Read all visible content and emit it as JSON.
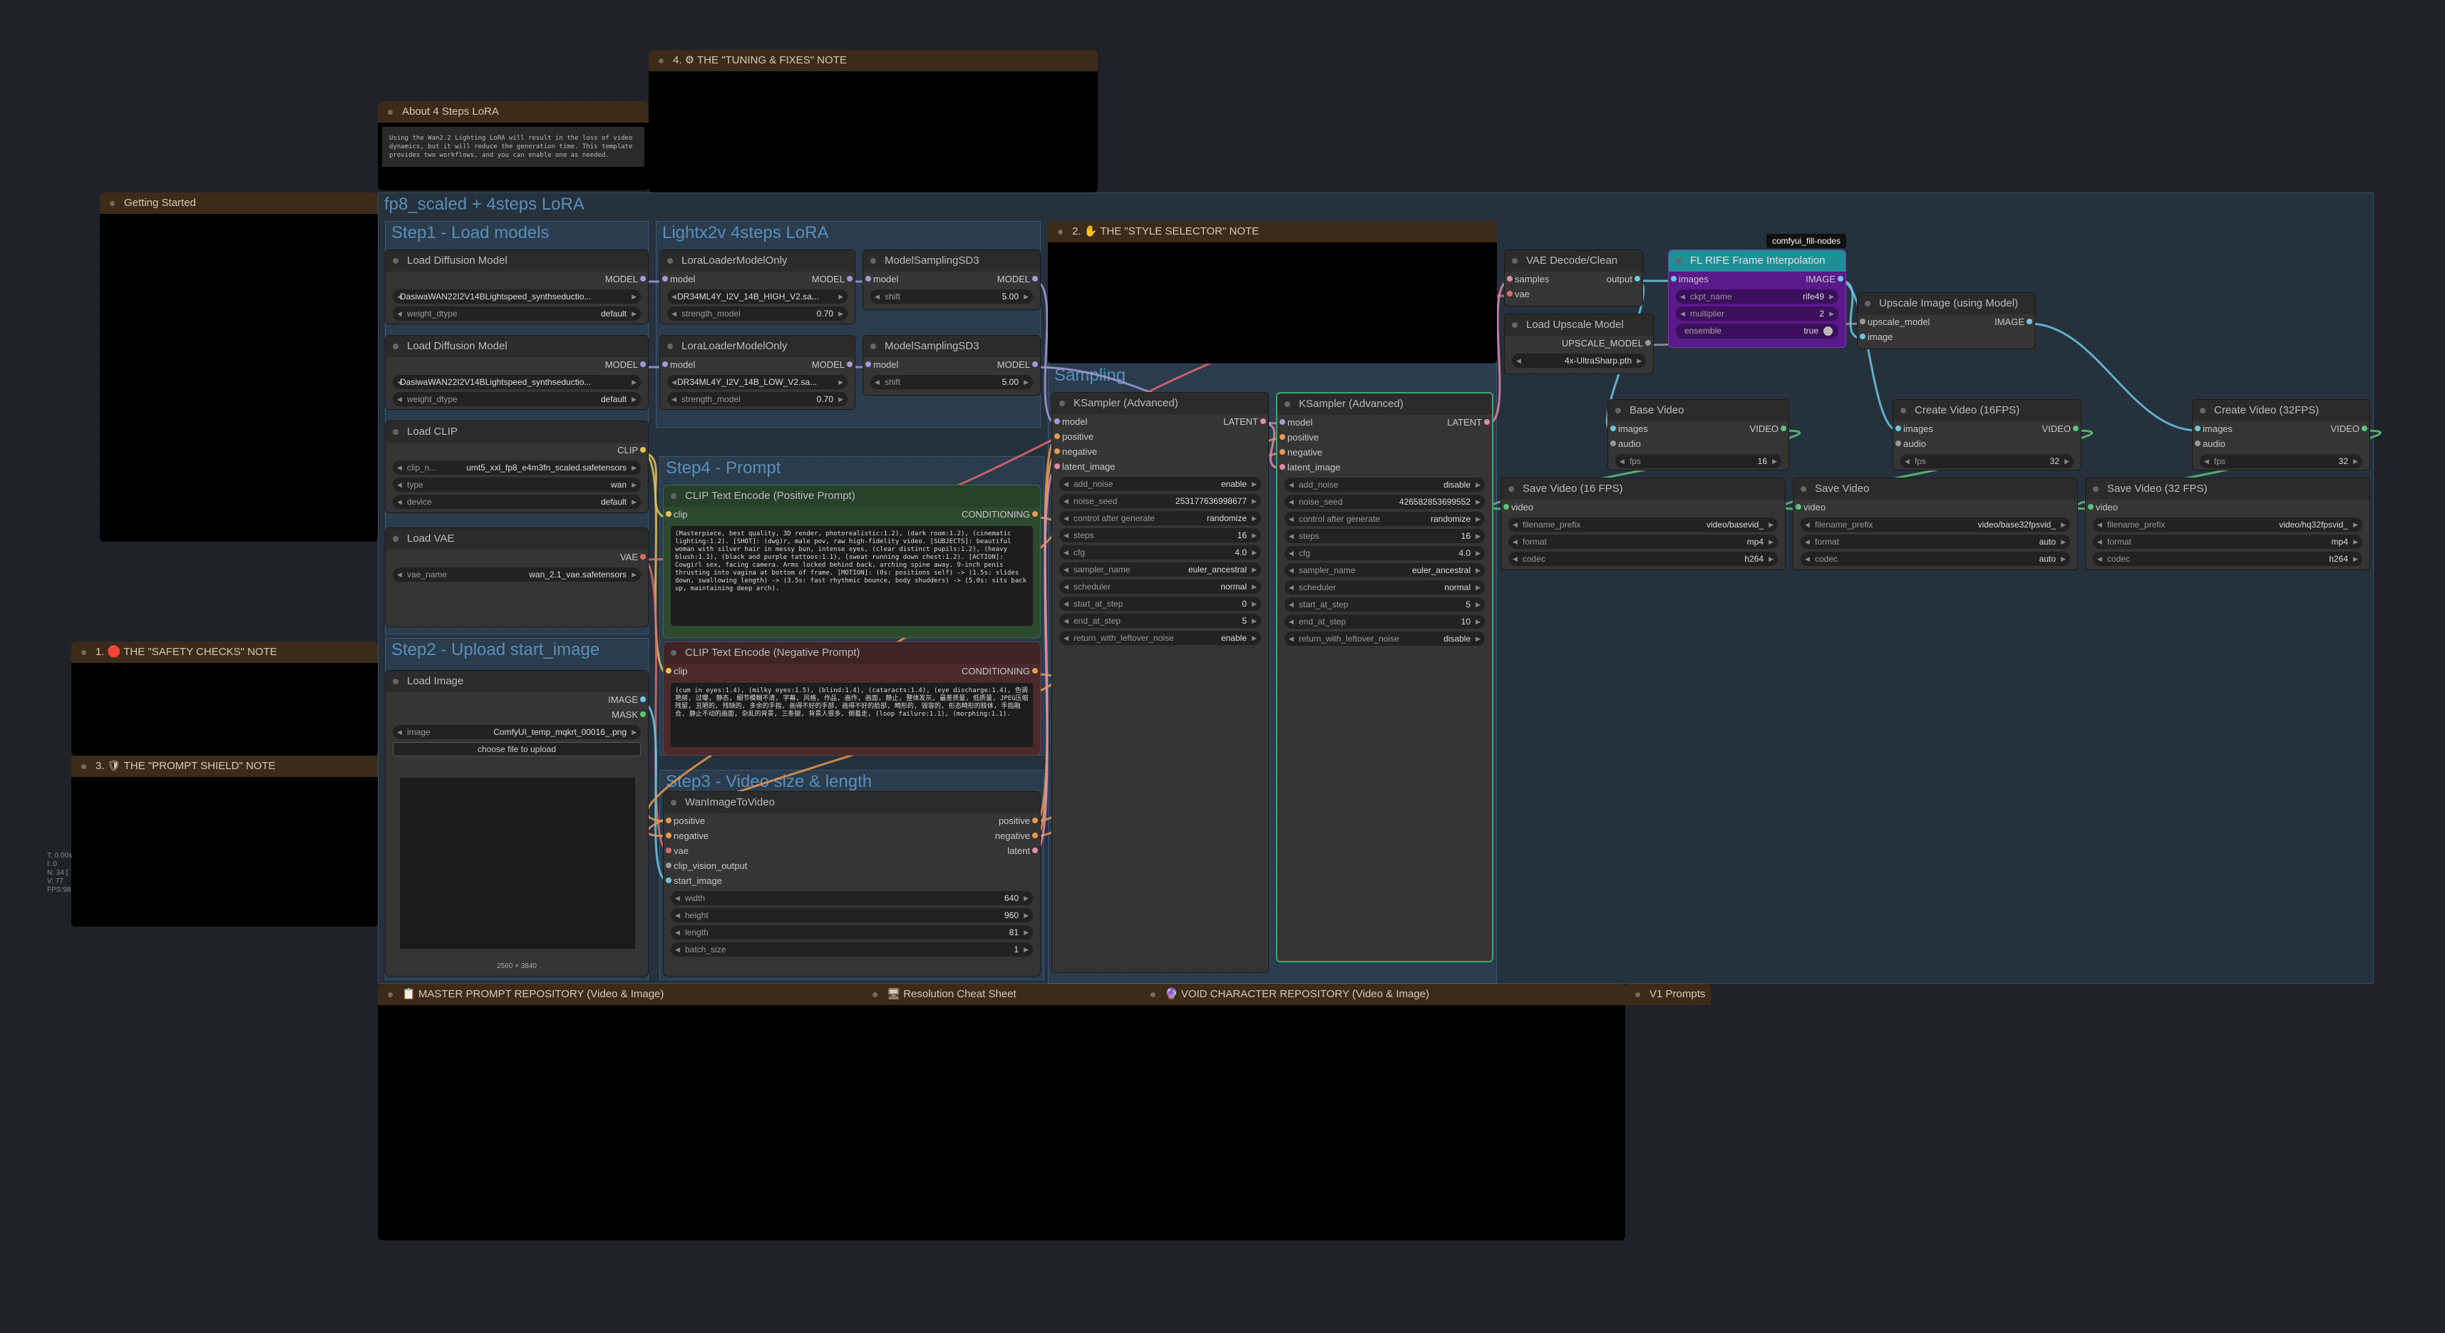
{
  "groups": {
    "main": "fp8_scaled +  4steps LoRA",
    "step1": "Step1 - Load models",
    "lightx": "Lightx2v 4steps LoRA",
    "sampling": "Sampling",
    "step4": "Step4 - Prompt",
    "step2": "Step2 - Upload start_image",
    "step3": "Step3 - Video size & length"
  },
  "notes": {
    "tuning": "4. ⚙ THE \"TUNING & FIXES\" NOTE",
    "about": "About 4 Steps LoRA",
    "about_text": "Using the Wan2.2 Lighting LoRA will result in the loss of video dynamics, but it will reduce the generation time. This template provides two workflows, and you can enable one as needed.",
    "getting_started": "Getting Started",
    "style": "2. ✋ THE \"STYLE SELECTOR\" NOTE",
    "safety": "1. 🛑 THE \"SAFETY CHECKS\" NOTE",
    "shield": "3. 🛡 THE \"PROMPT SHIELD\" NOTE",
    "master": "📋 MASTER PROMPT REPOSITORY (Video & Image)",
    "resolution": "🖥 Resolution Cheat Sheet",
    "void": "🔮 VOID CHARACTER REPOSITORY (Video & Image)",
    "v1": "V1 Prompts"
  },
  "stats": [
    "T: 0.00s",
    "I: 0",
    "N: 34 [",
    "V: 77",
    "FPS:98"
  ],
  "nodes": {
    "ldm1": {
      "title": "Load Diffusion Model",
      "out": "MODEL",
      "unet": "DasiwaWAN22I2V14BLightspeed_synthseductio...",
      "dtype_label": "weight_dtype",
      "dtype": "default"
    },
    "ldm2": {
      "title": "Load Diffusion Model",
      "out": "MODEL",
      "unet": "DasiwaWAN22I2V14BLightspeed_synthseductio...",
      "dtype_label": "weight_dtype",
      "dtype": "default"
    },
    "clip": {
      "title": "Load CLIP",
      "out": "CLIP",
      "name_label": "clip_n...",
      "name": "umt5_xxl_fp8_e4m3fn_scaled.safetensors",
      "type_label": "type",
      "type": "wan",
      "device_label": "device",
      "device": "default"
    },
    "vae": {
      "title": "Load VAE",
      "out": "VAE",
      "name_label": "vae_name",
      "name": "wan_2.1_vae.safetensors"
    },
    "lora1": {
      "title": "LoraLoaderModelOnly",
      "in": "model",
      "out": "MODEL",
      "name": "DR34ML4Y_I2V_14B_HIGH_V2.sa...",
      "strength_label": "strength_model",
      "strength": "0.70"
    },
    "lora2": {
      "title": "LoraLoaderModelOnly",
      "in": "model",
      "out": "MODEL",
      "name": "DR34ML4Y_I2V_14B_LOW_V2.sa...",
      "strength_label": "strength_model",
      "strength": "0.70"
    },
    "msd1": {
      "title": "ModelSamplingSD3",
      "in": "model",
      "out": "MODEL",
      "shift_label": "shift",
      "shift": "5.00"
    },
    "msd2": {
      "title": "ModelSamplingSD3",
      "in": "model",
      "out": "MODEL",
      "shift_label": "shift",
      "shift": "5.00"
    },
    "pos": {
      "title": "CLIP Text Encode (Positive Prompt)",
      "in": "clip",
      "out": "CONDITIONING",
      "text": "(Masterpiece, best quality, 3D render, photorealistic:1.2), (dark room:1.2), (cinematic lighting:1.2). [SHOT]: (dwg)r, male pov, raw high-fidelity video. [SUBJECTS]: beautiful woman with silver hair in messy bun, intense eyes, (clear distinct pupils:1.2), (heavy blush:1.1), (black and purple tattoos:1.1), (sweat running down chest:1.2). [ACTION]: Cowgirl sex, facing camera. Arms locked behind back, arching spine away. 9-inch penis thrusting into vagina at bottom of frame. [MOTION]: (0s: positions self) -> (1.5s: slides down, swallowing length) -> (3.5s: fast rhythmic bounce, body shudders) -> (5.0s: sits back up, maintaining deep arch)."
    },
    "neg": {
      "title": "CLIP Text Encode (Negative Prompt)",
      "in": "clip",
      "out": "CONDITIONING",
      "text": "(cum in eyes:1.4), (milky eyes:1.5), (blind:1.4), (cataracts:1.4), (eye discharge:1.4), 色调艳丽, 过曝, 静态, 细节模糊不清, 字幕, 风格, 作品, 画作, 画面, 静止, 整体发灰, 最差质量, 低质量, JPEG压缩残留, 丑陋的, 残缺的, 多余的手指, 画得不好的手部, 画得不好的脸部, 畸形的, 毁容的, 形态畸形的肢体, 手指融合, 静止不动的画面, 杂乱的背景, 三条腿, 背景人很多, 倒着走, (loop failure:1.1), (morphing:1.1)."
    },
    "img": {
      "title": "Load Image",
      "out1": "IMAGE",
      "out2": "MASK",
      "image_label": "image",
      "image": "ComfyUI_temp_mqkrt_00016_.png",
      "upload": "choose file to upload",
      "size": "2560 × 3840"
    },
    "wan": {
      "title": "WanImageToVideo",
      "in": [
        "positive",
        "negative",
        "vae",
        "clip_vision_output",
        "start_image"
      ],
      "out": [
        "positive",
        "negative",
        "latent"
      ],
      "widgets": [
        [
          "width",
          "640"
        ],
        [
          "height",
          "960"
        ],
        [
          "length",
          "81"
        ],
        [
          "batch_size",
          "1"
        ]
      ]
    },
    "ks1": {
      "title": "KSampler (Advanced)",
      "in": [
        "model",
        "positive",
        "negative",
        "latent_image"
      ],
      "out": "LATENT",
      "widgets": [
        [
          "add_noise",
          "enable"
        ],
        [
          "noise_seed",
          "253177636998677"
        ],
        [
          "control after generate",
          "randomize"
        ],
        [
          "steps",
          "16"
        ],
        [
          "cfg",
          "4.0"
        ],
        [
          "sampler_name",
          "euler_ancestral"
        ],
        [
          "scheduler",
          "normal"
        ],
        [
          "start_at_step",
          "0"
        ],
        [
          "end_at_step",
          "5"
        ],
        [
          "return_with_leftover_noise",
          "enable"
        ]
      ]
    },
    "ks2": {
      "title": "KSampler (Advanced)",
      "in": [
        "model",
        "positive",
        "negative",
        "latent_image"
      ],
      "out": "LATENT",
      "widgets": [
        [
          "add_noise",
          "disable"
        ],
        [
          "noise_seed",
          "426582853699552"
        ],
        [
          "control after generate",
          "randomize"
        ],
        [
          "steps",
          "16"
        ],
        [
          "cfg",
          "4.0"
        ],
        [
          "sampler_name",
          "euler_ancestral"
        ],
        [
          "scheduler",
          "normal"
        ],
        [
          "start_at_step",
          "5"
        ],
        [
          "end_at_step",
          "10"
        ],
        [
          "return_with_leftover_noise",
          "disable"
        ]
      ]
    },
    "vaedec": {
      "title": "VAE Decode/Clean",
      "in": [
        "samples",
        "vae"
      ],
      "out": "output"
    },
    "upload": {
      "title": "Load Upscale Model",
      "out": "UPSCALE_MODEL",
      "name": "4x-UltraSharp.pth"
    },
    "rife": {
      "badge": "comfyui_fill-nodes",
      "title": "FL RIFE Frame Interpolation",
      "in": "images",
      "out": "IMAGE",
      "widgets": [
        [
          "ckpt_name",
          "rife49"
        ],
        [
          "multiplier",
          "2"
        ]
      ],
      "ensemble_label": "ensemble",
      "ensemble": "true"
    },
    "upscale": {
      "title": "Upscale Image (using Model)",
      "in": [
        "upscale_model",
        "image"
      ],
      "out": "IMAGE"
    },
    "basevid": {
      "title": "Base Video",
      "in": [
        "images",
        "audio"
      ],
      "out": "VIDEO",
      "fps_label": "fps",
      "fps": "16"
    },
    "cv16": {
      "title": "Create Video (16FPS)",
      "in": [
        "images",
        "audio"
      ],
      "out": "VIDEO",
      "fps_label": "fps",
      "fps": "32"
    },
    "cv32": {
      "title": "Create Video (32FPS)",
      "in": [
        "images",
        "audio"
      ],
      "out": "VIDEO",
      "fps_label": "fps",
      "fps": "32"
    },
    "sv16": {
      "title": "Save Video (16 FPS)",
      "in": "video",
      "widgets": [
        [
          "filename_prefix",
          "video/basevid_"
        ],
        [
          "format",
          "mp4"
        ],
        [
          "codec",
          "h264"
        ]
      ]
    },
    "sv": {
      "title": "Save Video",
      "in": "video",
      "widgets": [
        [
          "filename_prefix",
          "video/base32fpsvid_"
        ],
        [
          "format",
          "auto"
        ],
        [
          "codec",
          "auto"
        ]
      ]
    },
    "sv32": {
      "title": "Save Video (32 FPS)",
      "in": "video",
      "widgets": [
        [
          "filename_prefix",
          "video/hq32fpsvid_"
        ],
        [
          "format",
          "mp4"
        ],
        [
          "codec",
          "h264"
        ]
      ]
    }
  },
  "colors": {
    "model": "#a59ad8",
    "clip": "#e6c35a",
    "vae": "#e06a6a",
    "conditioning": "#e89a52",
    "latent": "#e38aa8",
    "image": "#6fc6e0",
    "video": "#5fc47a"
  }
}
